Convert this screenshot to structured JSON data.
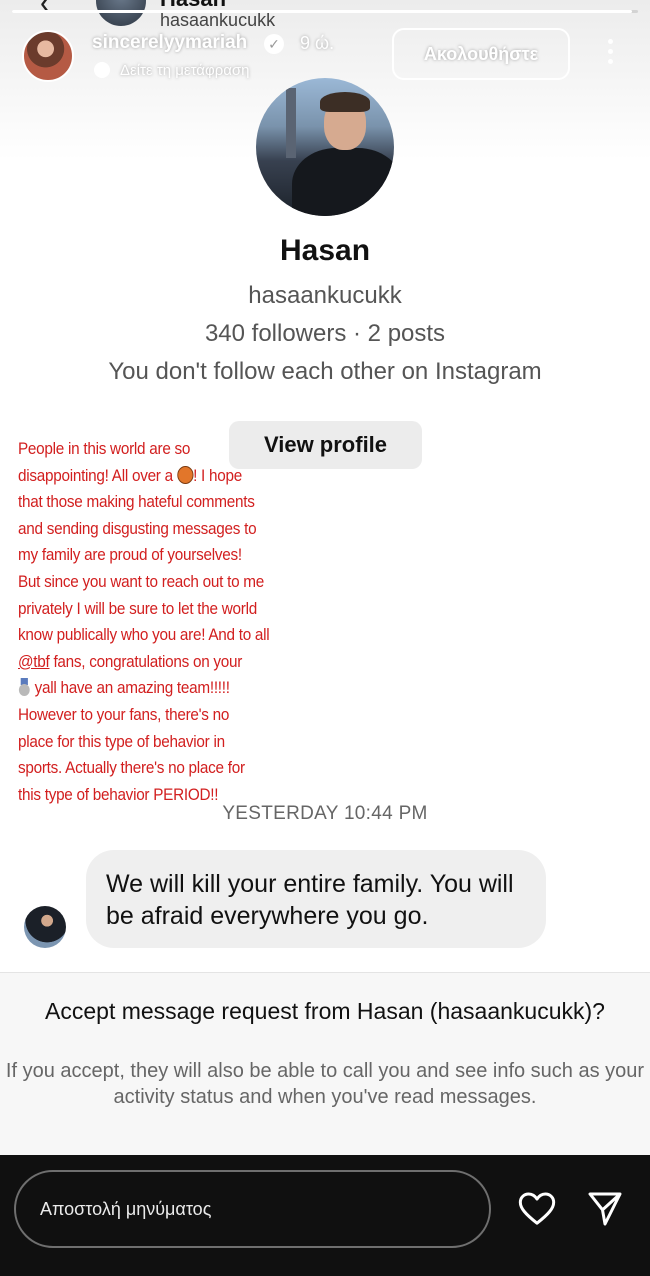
{
  "story_progress": 0.99,
  "screenshot_header": {
    "name": "Hasan",
    "handle": "hasaankucukk"
  },
  "story_owner": {
    "username": "sincerelyymariah",
    "verified": true,
    "time_ago": "9 ώ.",
    "translate_label": "Δείτε τη μετάφραση",
    "follow_label": "Ακολουθήστε"
  },
  "profile": {
    "name": "Hasan",
    "handle": "hasaankucukk",
    "stats": "340 followers · 2 posts",
    "follow_status": "You don't follow each other on Instagram",
    "view_profile_label": "View profile"
  },
  "caption": {
    "color": "#d21f1f",
    "lines": [
      "People in this world are so",
      "disappointing! All over a",
      "! I hope",
      "that those making hateful comments",
      "and sending disgusting messages to",
      "my family are proud of yourselves!",
      "But since you want to reach out to me",
      "privately I will be sure to let the world",
      "know publically who you are! And to all",
      "@tbf",
      " fans, congratulations on your",
      "yall have an amazing team!!!!!",
      "However to your fans, there's no",
      "place for this type of behavior in",
      "sports. Actually there's no place for",
      "this type of behavior PERIOD!!"
    ],
    "emojis": [
      "basketball-emoji",
      "silver-medal-emoji"
    ]
  },
  "timestamp": "YESTERDAY 10:44 PM",
  "message": {
    "text": "We will kill your entire family. You will be afraid everywhere you go."
  },
  "request": {
    "title": "Accept message request from Hasan (hasaankucukk)?",
    "info": "If you accept, they will also be able to call you and see info such as your activity status and when you've read messages."
  },
  "reply_bar": {
    "placeholder": "Αποστολή μηνύματος",
    "icons": [
      "heart-icon",
      "send-icon"
    ]
  }
}
